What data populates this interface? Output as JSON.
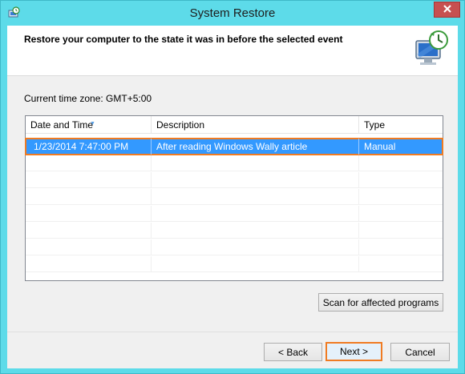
{
  "window": {
    "title": "System Restore",
    "close_icon": "close-icon",
    "app_icon": "system-restore-icon"
  },
  "header": {
    "heading": "Restore your computer to the state it was in before the selected event",
    "icon": "system-restore-monitor-icon"
  },
  "timezone_label": "Current time zone: GMT+5:00",
  "restore_points": {
    "columns": [
      "Date and Time",
      "Description",
      "Type"
    ],
    "sorted_column": "Date and Time",
    "rows": [
      {
        "date": "1/23/2014 7:47:00 PM",
        "description": "After reading Windows Wally article",
        "type": "Manual",
        "selected": true
      }
    ]
  },
  "buttons": {
    "scan": "Scan for affected programs",
    "back": "< Back",
    "next": "Next >",
    "cancel": "Cancel"
  },
  "colors": {
    "frame": "#5ddbe9",
    "selection": "#3399ff",
    "highlight_outline": "#f07b22",
    "close_button": "#c75050"
  }
}
